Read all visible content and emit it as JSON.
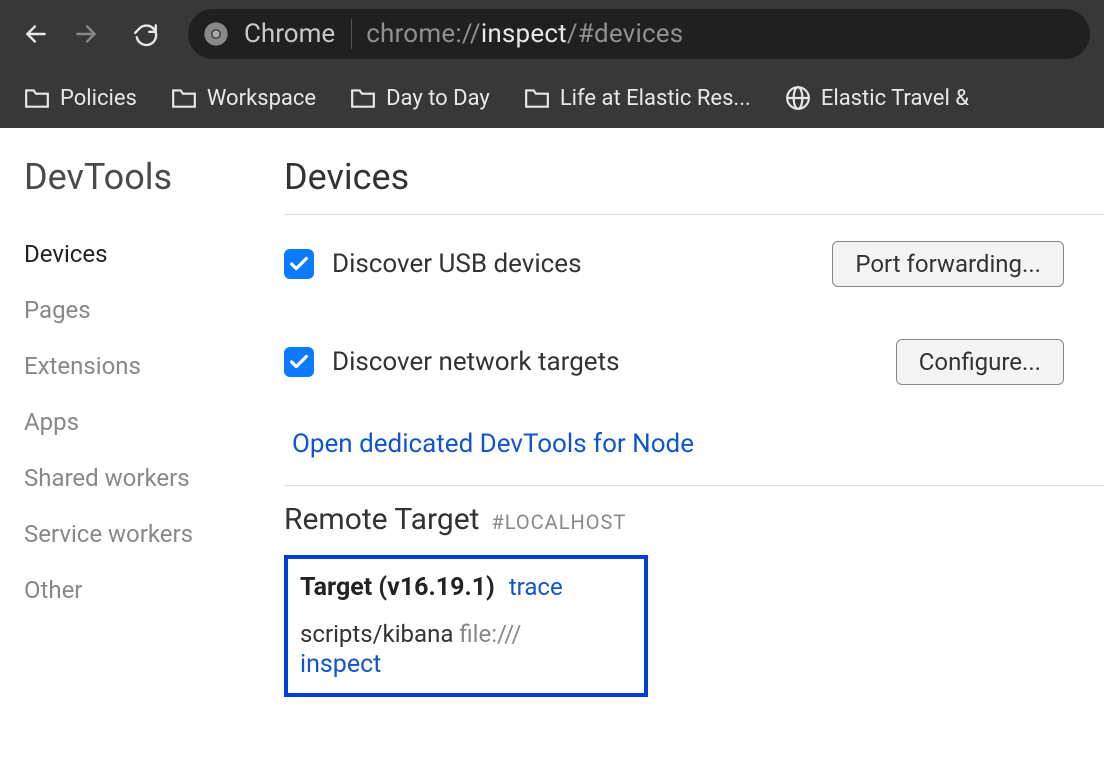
{
  "toolbar": {
    "browser_label": "Chrome",
    "url_prefix": "chrome://",
    "url_highlight": "inspect",
    "url_suffix": "/#devices"
  },
  "bookmarks": [
    {
      "label": "Policies",
      "icon": "folder"
    },
    {
      "label": "Workspace",
      "icon": "folder"
    },
    {
      "label": "Day to Day",
      "icon": "folder"
    },
    {
      "label": "Life at Elastic Res...",
      "icon": "folder"
    },
    {
      "label": "Elastic Travel &",
      "icon": "globe"
    }
  ],
  "sidebar": {
    "title": "DevTools",
    "items": [
      {
        "label": "Devices",
        "active": true
      },
      {
        "label": "Pages",
        "active": false
      },
      {
        "label": "Extensions",
        "active": false
      },
      {
        "label": "Apps",
        "active": false
      },
      {
        "label": "Shared workers",
        "active": false
      },
      {
        "label": "Service workers",
        "active": false
      },
      {
        "label": "Other",
        "active": false
      }
    ]
  },
  "main": {
    "title": "Devices",
    "options": [
      {
        "label": "Discover USB devices",
        "checked": true,
        "button": "Port forwarding..."
      },
      {
        "label": "Discover network targets",
        "checked": true,
        "button": "Configure..."
      }
    ],
    "node_link": "Open dedicated DevTools for Node",
    "remote": {
      "heading": "Remote Target",
      "sub": "#LOCALHOST",
      "target": {
        "name": "Target (v16.19.1)",
        "trace": "trace",
        "path": "scripts/kibana",
        "url": "file:///",
        "inspect": "inspect"
      }
    }
  }
}
